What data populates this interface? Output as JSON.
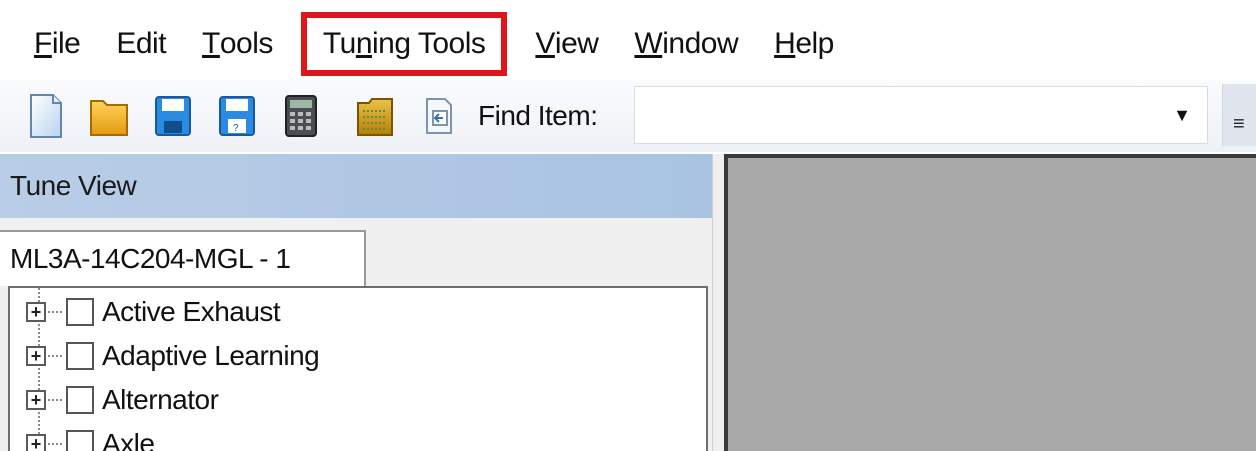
{
  "menu": {
    "items": [
      {
        "label": "File",
        "mnemonic": "F",
        "rest": "ile"
      },
      {
        "label": "Edit",
        "mnemonic": "",
        "rest": "Edit"
      },
      {
        "label": "Tools",
        "mnemonic": "T",
        "rest": "ools"
      },
      {
        "label": "Tuning Tools",
        "pre": "Tu",
        "mnemonic": "n",
        "rest": "ing Tools"
      },
      {
        "label": "View",
        "mnemonic": "V",
        "rest": "iew"
      },
      {
        "label": "Window",
        "mnemonic": "W",
        "rest": "indow"
      },
      {
        "label": "Help",
        "mnemonic": "H",
        "rest": "elp"
      }
    ],
    "highlight_color": "#e0141b"
  },
  "toolbar": {
    "buttons": [
      "new-document-icon",
      "open-folder-icon",
      "save-icon",
      "save-as-icon",
      "calculator-icon",
      "compare-icon",
      "export-icon"
    ],
    "find_label": "Find Item:",
    "find_value": ""
  },
  "tune_view": {
    "title": "Tune View",
    "tab_label": "ML3A-14C204-MGL - 1",
    "tree_items": [
      {
        "label": "Active Exhaust"
      },
      {
        "label": "Adaptive Learning"
      },
      {
        "label": "Alternator"
      },
      {
        "label": "Axle"
      }
    ]
  },
  "colors": {
    "panel_header": "#a9c3e3",
    "workspace": "#a9a9a9"
  }
}
